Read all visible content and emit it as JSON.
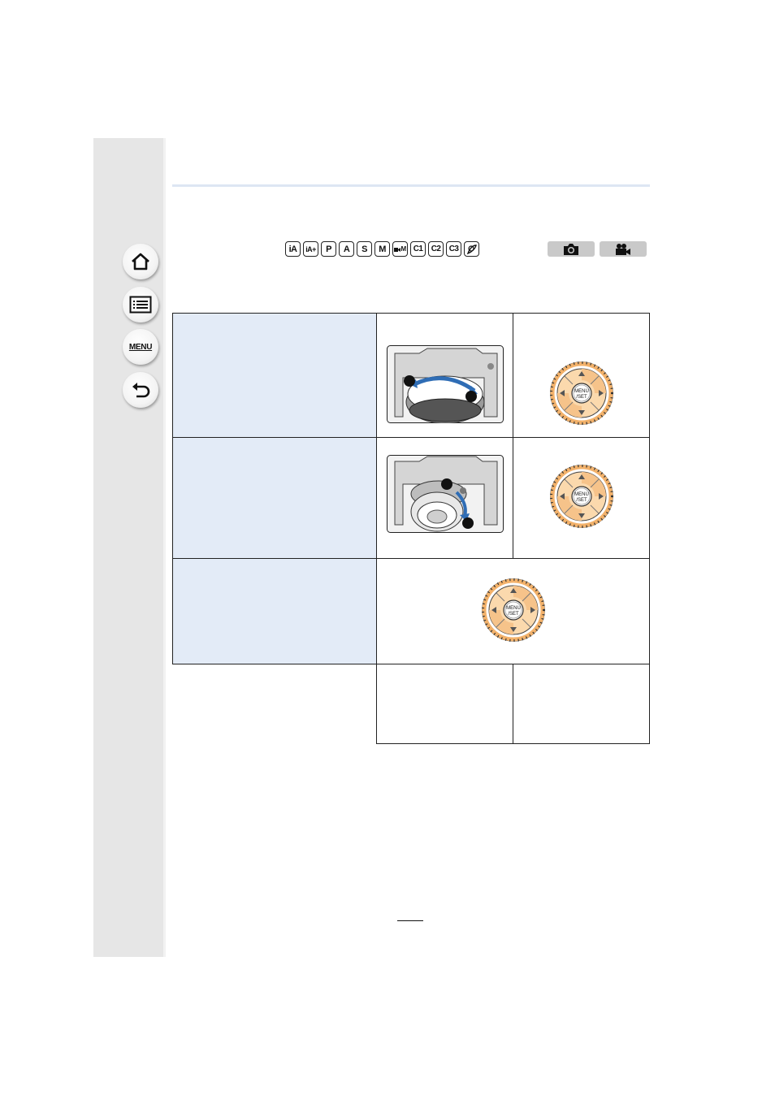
{
  "sidebar": {
    "buttons": [
      {
        "name": "home",
        "icon": "home-icon"
      },
      {
        "name": "contents",
        "icon": "list-icon"
      },
      {
        "name": "menu",
        "icon": "menu-icon",
        "label": "MENU"
      },
      {
        "name": "back",
        "icon": "back-arrow-icon"
      }
    ]
  },
  "modes": [
    "iA",
    "iA+",
    "P",
    "A",
    "S",
    "M",
    "M",
    "C1",
    "C2",
    "C3",
    "♪"
  ],
  "tags": [
    {
      "icon": "camera-icon"
    },
    {
      "icon": "movie-camera-icon"
    }
  ],
  "table": {
    "rows": [
      {
        "label": "",
        "cells": [
          {
            "type": "lens-photo",
            "markers": [
              "1",
              "2"
            ]
          },
          {
            "type": "control-dial"
          }
        ]
      },
      {
        "label": "",
        "cells": [
          {
            "type": "lens-photo",
            "markers": [
              "1",
              "2"
            ]
          },
          {
            "type": "control-dial"
          }
        ]
      },
      {
        "label": "",
        "cells": [
          {
            "type": "control-dial",
            "span": 2
          }
        ]
      },
      {
        "label": "",
        "cells": [
          {
            "type": "text",
            "value": ""
          },
          {
            "type": "text",
            "value": ""
          }
        ]
      }
    ]
  },
  "dial": {
    "center_top": "MENU",
    "center_bottom": "/SET"
  },
  "colors": {
    "accent_orange": "#f3b26b",
    "panel_blue": "#e3ebf7",
    "arrow_blue": "#2f6db5"
  },
  "page_number": ""
}
